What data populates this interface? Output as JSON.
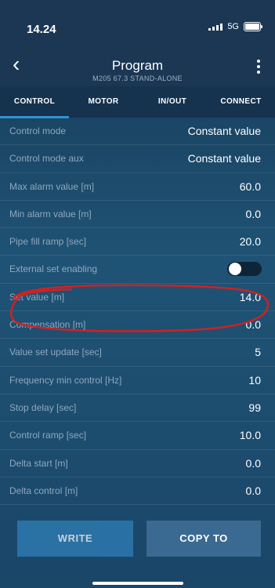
{
  "status_bar": {
    "time": "14.24",
    "network": "5G"
  },
  "header": {
    "title": "Program",
    "subtitle": "M205 67.3 STAND-ALONE"
  },
  "tabs": [
    {
      "label": "CONTROL",
      "active": true
    },
    {
      "label": "MOTOR",
      "active": false
    },
    {
      "label": "IN/OUT",
      "active": false
    },
    {
      "label": "CONNECT",
      "active": false
    }
  ],
  "rows": [
    {
      "label": "Control mode",
      "value": "Constant value"
    },
    {
      "label": "Control mode aux",
      "value": "Constant value"
    },
    {
      "label": "Max alarm value [m]",
      "value": "60.0"
    },
    {
      "label": "Min alarm value [m]",
      "value": "0.0"
    },
    {
      "label": "Pipe fill ramp [sec]",
      "value": "20.0"
    },
    {
      "label": "External set enabling",
      "value": "",
      "toggle_on": true
    },
    {
      "label": "Set value [m]",
      "value": "14.0"
    },
    {
      "label": "Compensation [m]",
      "value": "0.0"
    },
    {
      "label": "Value set update [sec]",
      "value": "5"
    },
    {
      "label": "Frequency min control [Hz]",
      "value": "10"
    },
    {
      "label": "Stop delay [sec]",
      "value": "99"
    },
    {
      "label": "Control ramp [sec]",
      "value": "10.0"
    },
    {
      "label": "Delta start [m]",
      "value": "0.0"
    },
    {
      "label": "Delta control [m]",
      "value": "0.0"
    }
  ],
  "buttons": {
    "write": "WRITE",
    "copy_to": "COPY TO"
  },
  "colors": {
    "accent": "#2e93d5",
    "highlight_annotation": "#d42020"
  }
}
